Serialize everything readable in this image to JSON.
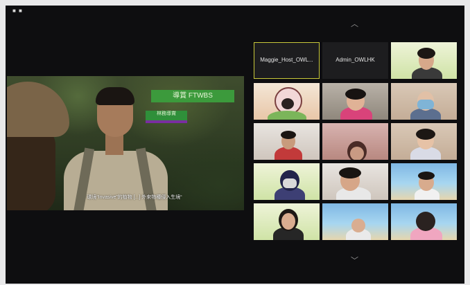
{
  "window": {
    "corner_text": "■ ■"
  },
  "shared_screen": {
    "name_tag": "導賞 FTWBS",
    "role_tag": "林務導賞",
    "subtitle": "環境“Invasive”的植物 [...] 外來物種侵入生境“"
  },
  "gallery": {
    "up_icon": "︿",
    "down_icon": "﹀",
    "tiles": [
      {
        "label": "Maggie_Host_OWL...",
        "active": true
      },
      {
        "label": "Admin_OWLHK",
        "active": false
      }
    ]
  }
}
